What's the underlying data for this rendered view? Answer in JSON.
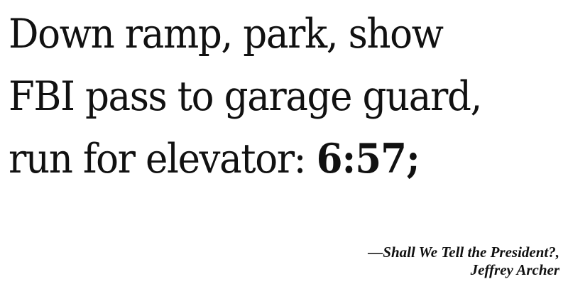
{
  "quote": {
    "line1": "Down ramp, park, show",
    "line2": "FBI pass to garage guard,",
    "line3_text": "run for elevator: ",
    "time": "6:57;"
  },
  "attribution": {
    "title": "—Shall We Tell the President?,",
    "author": "Jeffrey Archer"
  }
}
